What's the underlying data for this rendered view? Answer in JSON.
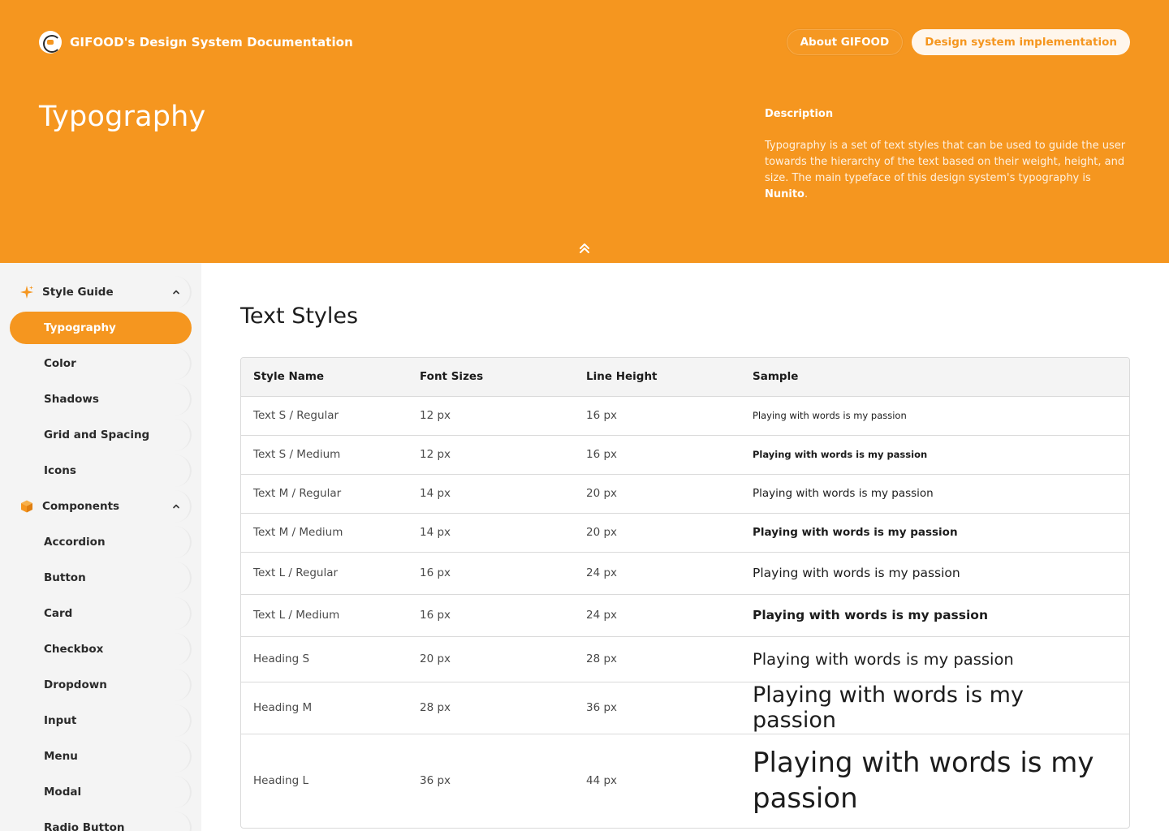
{
  "header": {
    "brand_title": "GIFOOD's Design System Documentation",
    "nav": [
      {
        "label": "About GIFOOD"
      },
      {
        "label": "Design system implementation"
      }
    ],
    "page_title": "Typography",
    "description": {
      "label": "Description",
      "text": "Typography is a set of text styles that can be used to guide the user towards the hierarchy of the text based on their weight, height, and size. The main typeface of this design system's typography is ",
      "emphasis": "Nunito",
      "end": "."
    },
    "collapse_icon": "double-chevron-up-icon"
  },
  "sidebar": {
    "sections": [
      {
        "label": "Style Guide",
        "icon": "sparkle-icon",
        "items": [
          "Typography",
          "Color",
          "Shadows",
          "Grid and Spacing",
          "Icons"
        ]
      },
      {
        "label": "Components",
        "icon": "cube-icon",
        "items": [
          "Accordion",
          "Button",
          "Card",
          "Checkbox",
          "Dropdown",
          "Input",
          "Menu",
          "Modal",
          "Radio Button"
        ]
      }
    ],
    "active_item": "Typography"
  },
  "main": {
    "section_title": "Text Styles",
    "table": {
      "headers": [
        "Style Name",
        "Font Sizes",
        "Line Height",
        "Sample"
      ],
      "sample_text": "Playing with words is my passion",
      "rows": [
        {
          "name": "Text S / Regular",
          "size": "12 px",
          "line": "16 px",
          "weight": "regular"
        },
        {
          "name": "Text S / Medium",
          "size": "12 px",
          "line": "16 px",
          "weight": "medium"
        },
        {
          "name": "Text M / Regular",
          "size": "14 px",
          "line": "20 px",
          "weight": "regular"
        },
        {
          "name": "Text M / Medium",
          "size": "14 px",
          "line": "20 px",
          "weight": "medium"
        },
        {
          "name": "Text L / Regular",
          "size": "16 px",
          "line": "24 px",
          "weight": "regular"
        },
        {
          "name": "Text L / Medium",
          "size": "16 px",
          "line": "24 px",
          "weight": "medium"
        },
        {
          "name": "Heading S",
          "size": "20 px",
          "line": "28 px",
          "weight": "regular"
        },
        {
          "name": "Heading M",
          "size": "28 px",
          "line": "36 px",
          "weight": "regular"
        },
        {
          "name": "Heading L",
          "size": "36 px",
          "line": "44 px",
          "weight": "regular"
        }
      ]
    }
  },
  "colors": {
    "brand_orange": "#F5961F",
    "sidebar_bg": "#F4F4F4",
    "table_header_bg": "#F4F4F4",
    "border": "#DADADA"
  }
}
